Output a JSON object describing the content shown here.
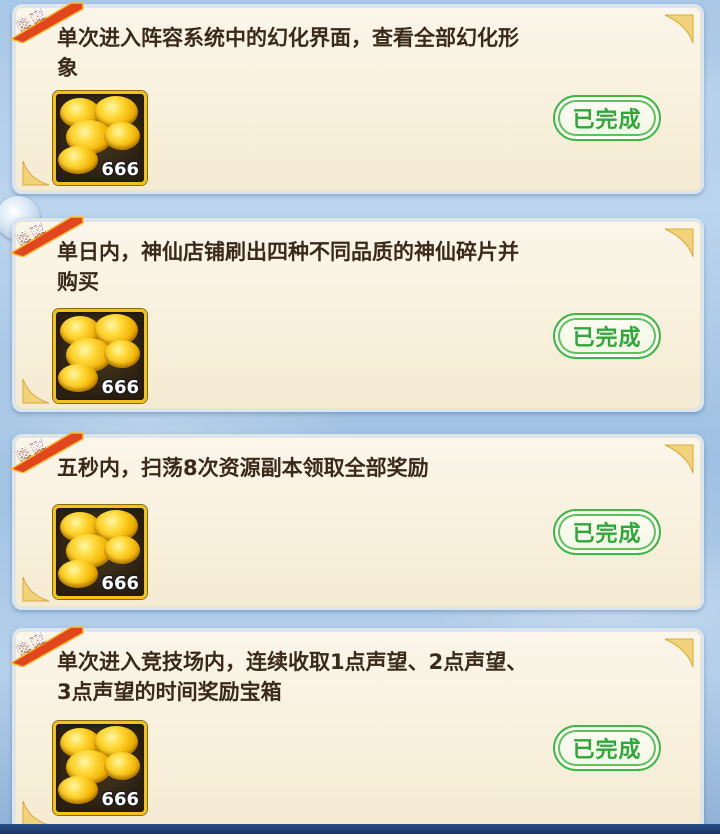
{
  "tasks": [
    {
      "tag": "隐藏",
      "description": "单次进入阵容系统中的幻化界面，查看全部幻化形象",
      "reward": {
        "icon": "gold-ingot-icon",
        "count": "666"
      },
      "status": "已完成"
    },
    {
      "tag": "隐藏",
      "description": "单日内，神仙店铺刷出四种不同品质的神仙碎片并购买",
      "reward": {
        "icon": "gold-ingot-icon",
        "count": "666"
      },
      "status": "已完成"
    },
    {
      "tag": "隐藏",
      "description": "五秒内，扫荡8次资源副本领取全部奖励",
      "reward": {
        "icon": "gold-ingot-icon",
        "count": "666"
      },
      "status": "已完成"
    },
    {
      "tag": "隐藏",
      "description": "单次进入竞技场内，连续收取1点声望、2点声望、3点声望的时间奖励宝箱",
      "reward": {
        "icon": "gold-ingot-icon",
        "count": "666"
      },
      "status": "已完成"
    }
  ],
  "colors": {
    "tag_red": "#e2461c",
    "button_green": "#2fa83a",
    "reward_border": "#f2c21a",
    "card_bg": "#f8f0dc"
  }
}
